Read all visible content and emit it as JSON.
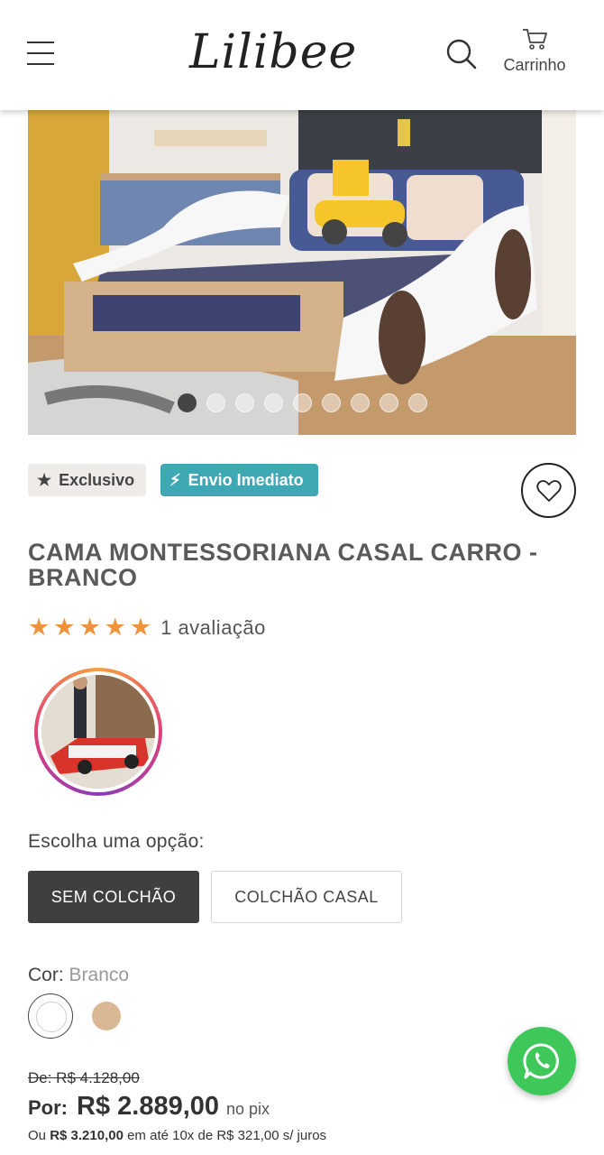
{
  "header": {
    "logo_text": "Lilibee",
    "cart_label": "Carrinho",
    "icons": {
      "menu": "hamburger-menu-icon",
      "search": "search-icon",
      "cart": "cart-icon"
    }
  },
  "gallery": {
    "total_slides": 9,
    "active_slide": 1
  },
  "badges": {
    "exclusive": {
      "label": "Exclusivo",
      "icon": "star-icon"
    },
    "shipping": {
      "label": "Envio Imediato",
      "icon": "lightning-icon",
      "color": "#3fa8b5"
    }
  },
  "product": {
    "title": "CAMA MONTESSORIANA CASAL CARRO - BRANCO",
    "rating": {
      "stars": 5,
      "label": "1 avaliação",
      "star_color": "#f0923a"
    }
  },
  "options": {
    "label": "Escolha uma opção:",
    "items": [
      "SEM COLCHÃO",
      "COLCHÃO CASAL"
    ],
    "selected": "SEM COLCHÃO"
  },
  "color": {
    "label": "Cor:",
    "value": "Branco",
    "swatches": [
      {
        "name": "Branco",
        "hex": "#ffffff"
      },
      {
        "name": "Madeira",
        "hex": "#d9b994"
      }
    ]
  },
  "price": {
    "old": "De: R$ 4.128,00",
    "por_label": "Por:",
    "current": "R$ 2.889,00",
    "pix_label": "no pix",
    "installments_prefix": "Ou",
    "installments_total": "R$ 3.210,00",
    "installments_suffix": "em até 10x de R$ 321,00 s/ juros"
  },
  "floating": {
    "whatsapp_icon": "whatsapp-icon",
    "color": "#3ec85a"
  }
}
